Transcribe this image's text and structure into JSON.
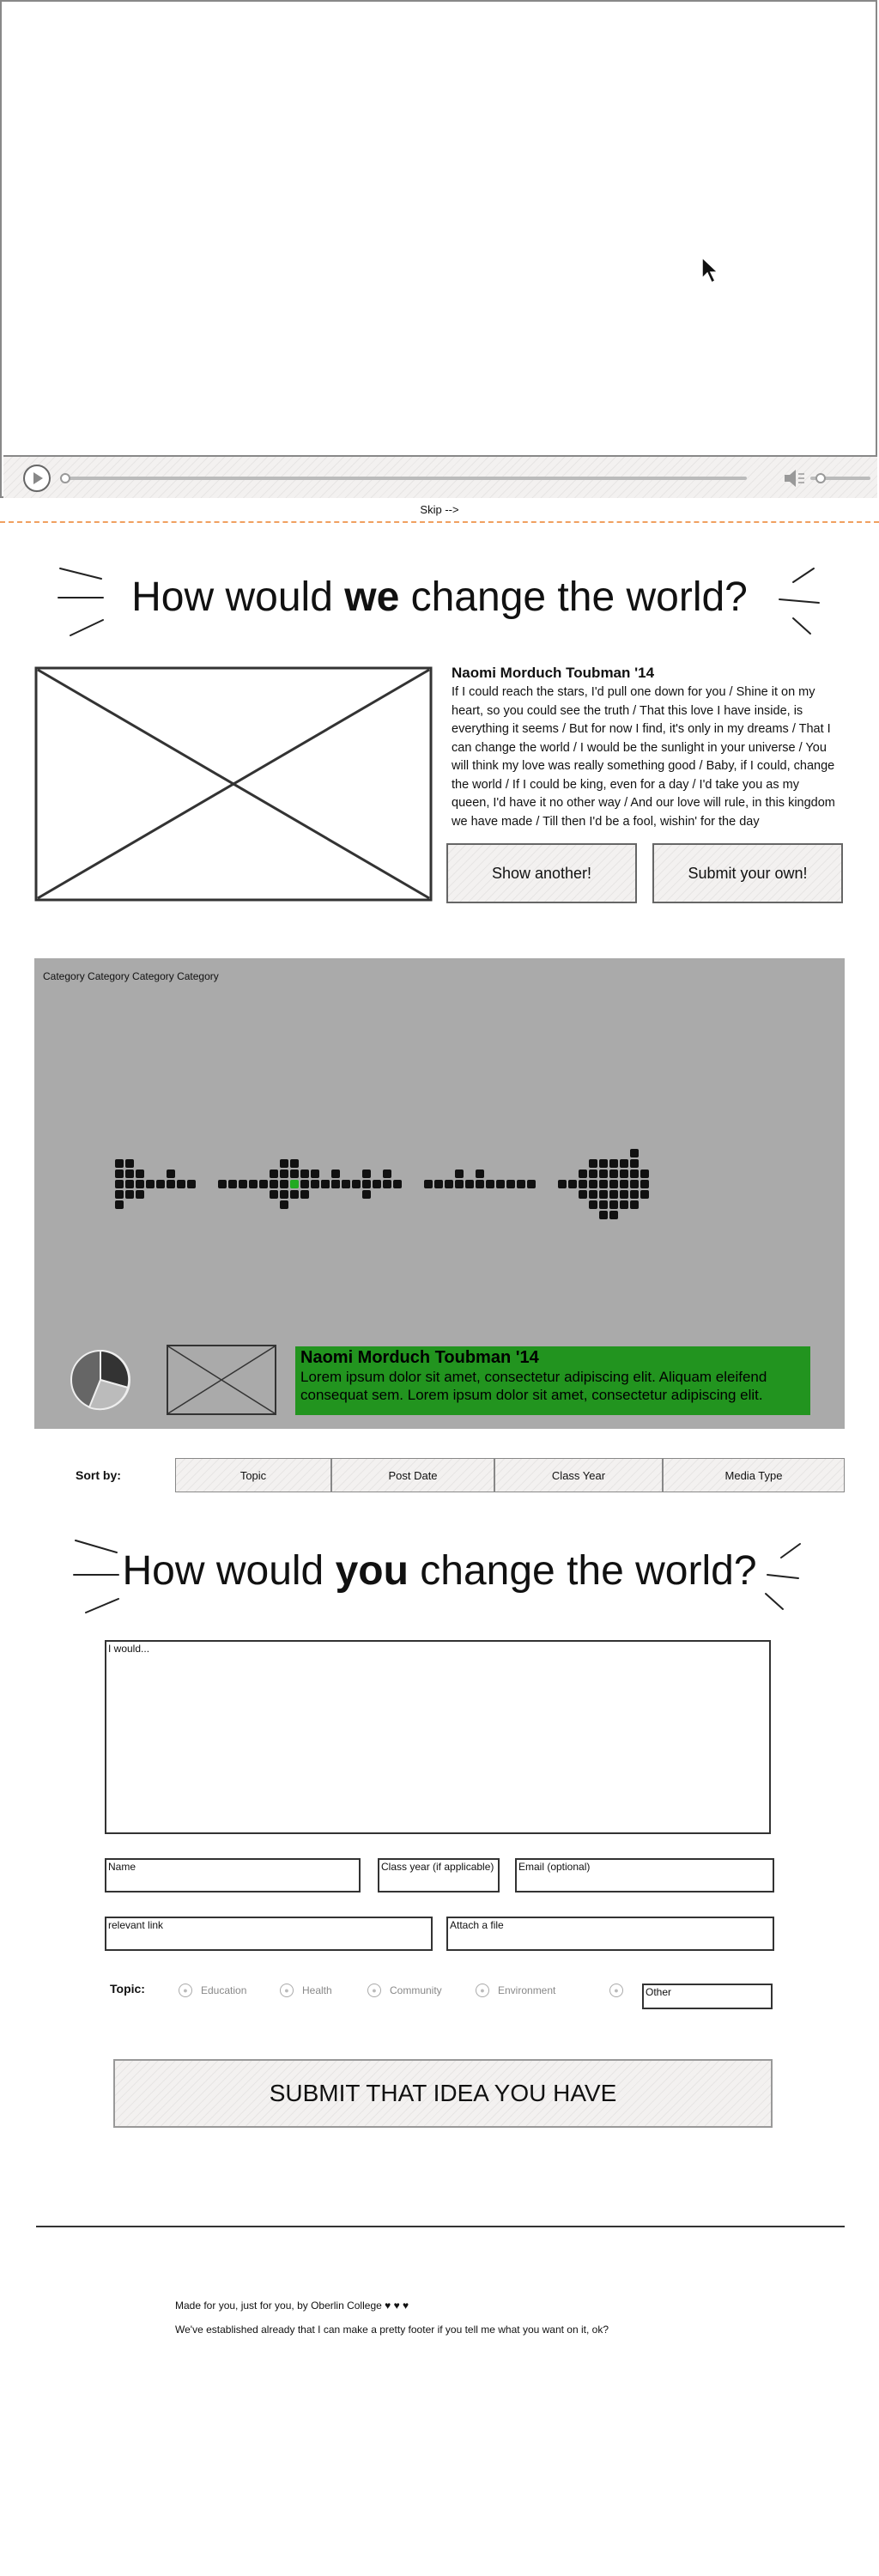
{
  "video": {
    "skip_label": "Skip -->"
  },
  "hero": {
    "title_before": "How would ",
    "title_emphasis": "we",
    "title_after": " change the world?"
  },
  "story": {
    "author": "Naomi Morduch Toubman '14",
    "text": "If I could reach the stars, I'd pull one down for you / Shine it on my heart, so you could see the truth / That this love I have inside, is everything it seems / But for now I find, it's only in my dreams / That I can change the world / I would be the sunlight in your universe / You will think my love was really something good / Baby, if I could, change the world / If I could be king, even for a day / I'd take you as my queen, I'd have it no other way / And our love will rule, in this kingdom we have made / Till then I'd be a fool, wishin' for the day",
    "show_another_label": "Show another!",
    "submit_own_label": "Submit your own!"
  },
  "visualization": {
    "categories_label": "Category Category Category Category",
    "highlight_color": "#22aa22",
    "caption_color": "#22941f",
    "caption": {
      "author": "Naomi Morduch Toubman '14",
      "text": "Lorem ipsum dolor sit amet, consectetur adipiscing elit. Aliquam eleifend consequat sem. Lorem ipsum dolor sit amet, consectetur adipiscing elit."
    }
  },
  "sort": {
    "label": "Sort by:",
    "options": [
      "Topic",
      "Post Date",
      "Class Year",
      "Media Type"
    ]
  },
  "form": {
    "title_before": "How would ",
    "title_emphasis": "you",
    "title_after": " change the world?",
    "idea_placeholder": "I would...",
    "name_placeholder": "Name",
    "class_year_placeholder": "Class year (if applicable)",
    "email_placeholder": "Email (optional)",
    "link_placeholder": "relevant link",
    "attach_placeholder": "Attach a file",
    "topic_label": "Topic:",
    "topics": [
      "Education",
      "Health",
      "Community",
      "Environment"
    ],
    "other_placeholder": "Other",
    "submit_label": "SUBMIT THAT IDEA YOU HAVE"
  },
  "footer": {
    "made_by": "Made for you, just for you, by Oberlin College ♥ ♥ ♥",
    "note": "We've established already that I can make a pretty footer if you tell me what you want on it, ok?"
  }
}
